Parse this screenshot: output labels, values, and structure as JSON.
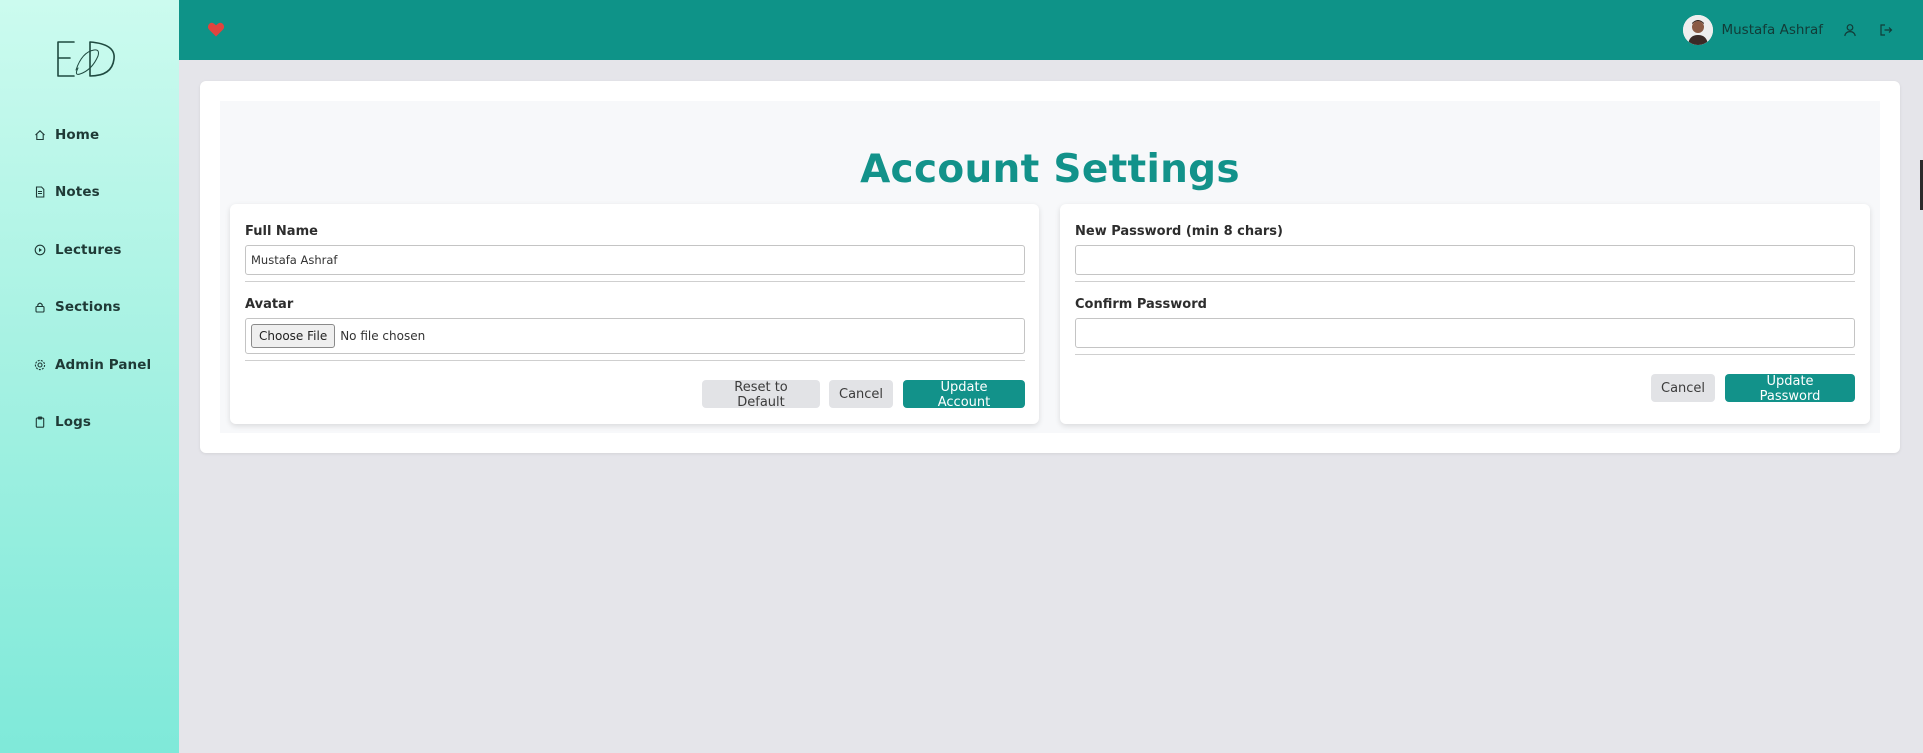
{
  "sidebar": {
    "logo_text": "E&D",
    "items": [
      {
        "label": "Home",
        "icon": "home-icon"
      },
      {
        "label": "Notes",
        "icon": "document-icon"
      },
      {
        "label": "Lectures",
        "icon": "play-circle-icon"
      },
      {
        "label": "Sections",
        "icon": "lock-icon"
      },
      {
        "label": "Admin Panel",
        "icon": "gear-icon"
      },
      {
        "label": "Logs",
        "icon": "clipboard-icon"
      }
    ]
  },
  "header": {
    "brand_icon": "heart-icon",
    "user_name": "Mustafa Ashraf",
    "icons": [
      "user-icon",
      "logout-icon"
    ]
  },
  "colors": {
    "header": "#0e9388",
    "accent": "#12928a",
    "heart": "#e0443e",
    "sidebar_top": "#ccfbef",
    "sidebar_bottom": "#7fe9d9"
  },
  "page": {
    "title": "Account Settings"
  },
  "account_form": {
    "full_name_label": "Full Name",
    "full_name_value": "Mustafa Ashraf",
    "avatar_label": "Avatar",
    "choose_file_label": "Choose File",
    "file_status": "No file chosen",
    "reset_label": "Reset to Default",
    "cancel_label": "Cancel",
    "submit_label": "Update Account"
  },
  "password_form": {
    "new_password_label": "New Password (min 8 chars)",
    "new_password_value": "",
    "confirm_password_label": "Confirm Password",
    "confirm_password_value": "",
    "cancel_label": "Cancel",
    "submit_label": "Update Password"
  }
}
